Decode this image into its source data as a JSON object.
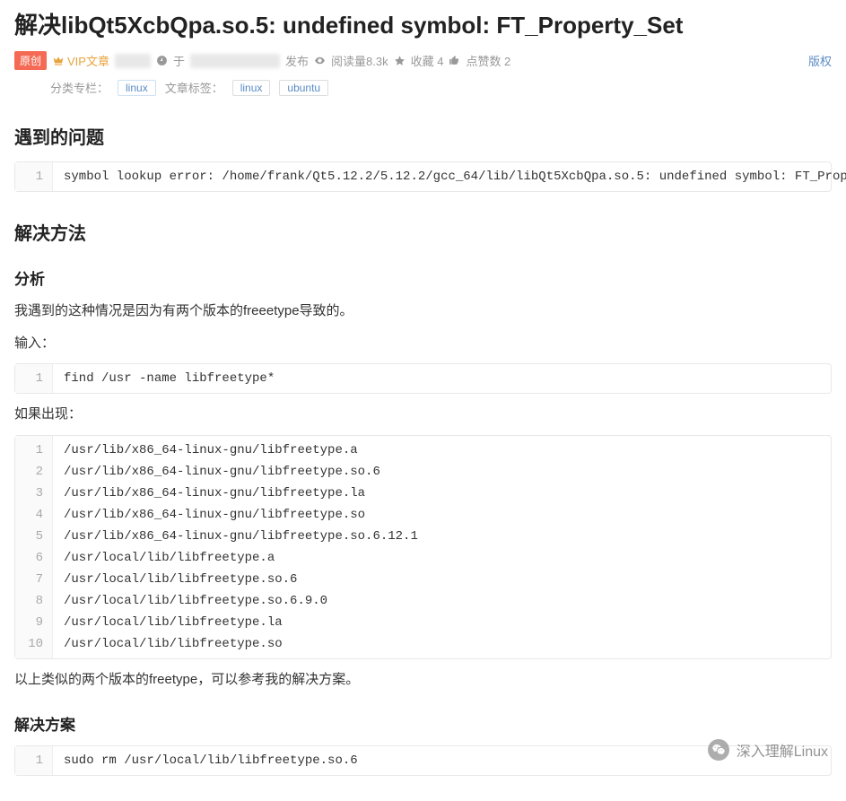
{
  "title": "解决libQt5XcbQpa.so.5: undefined symbol: FT_Property_Set",
  "meta": {
    "original_badge": "原创",
    "vip_label": "VIP文章",
    "time_prefix": "于",
    "publish_label": "发布",
    "views": "阅读量8.3k",
    "favorites": "收藏 4",
    "likes": "点赞数 2",
    "copyright": "版权"
  },
  "meta2": {
    "category_label": "分类专栏：",
    "category_tag": "linux",
    "tags_label": "文章标签：",
    "tag1": "linux",
    "tag2": "ubuntu"
  },
  "sections": {
    "problem_heading": "遇到的问题",
    "problem_code": [
      "symbol lookup error: /home/frank/Qt5.12.2/5.12.2/gcc_64/lib/libQt5XcbQpa.so.5: undefined symbol: FT_Property_Set"
    ],
    "solution_heading": "解决方法",
    "analysis_heading": "分析",
    "analysis_p1": "我遇到的这种情况是因为有两个版本的freeetype导致的。",
    "analysis_p2": "输入：",
    "analysis_code": [
      "find /usr -name libfreetype*"
    ],
    "if_appear": "如果出现：",
    "output_code": [
      "/usr/lib/x86_64-linux-gnu/libfreetype.a",
      "/usr/lib/x86_64-linux-gnu/libfreetype.so.6",
      "/usr/lib/x86_64-linux-gnu/libfreetype.la",
      "/usr/lib/x86_64-linux-gnu/libfreetype.so",
      "/usr/lib/x86_64-linux-gnu/libfreetype.so.6.12.1",
      "/usr/local/lib/libfreetype.a",
      "/usr/local/lib/libfreetype.so.6",
      "/usr/local/lib/libfreetype.so.6.9.0",
      "/usr/local/lib/libfreetype.la",
      "/usr/local/lib/libfreetype.so"
    ],
    "conclusion_p": "以上类似的两个版本的freetype，可以参考我的解决方案。",
    "fix_heading": "解决方案",
    "fix_code": [
      "sudo rm /usr/local/lib/libfreetype.so.6"
    ]
  },
  "watermark": "深入理解Linux"
}
